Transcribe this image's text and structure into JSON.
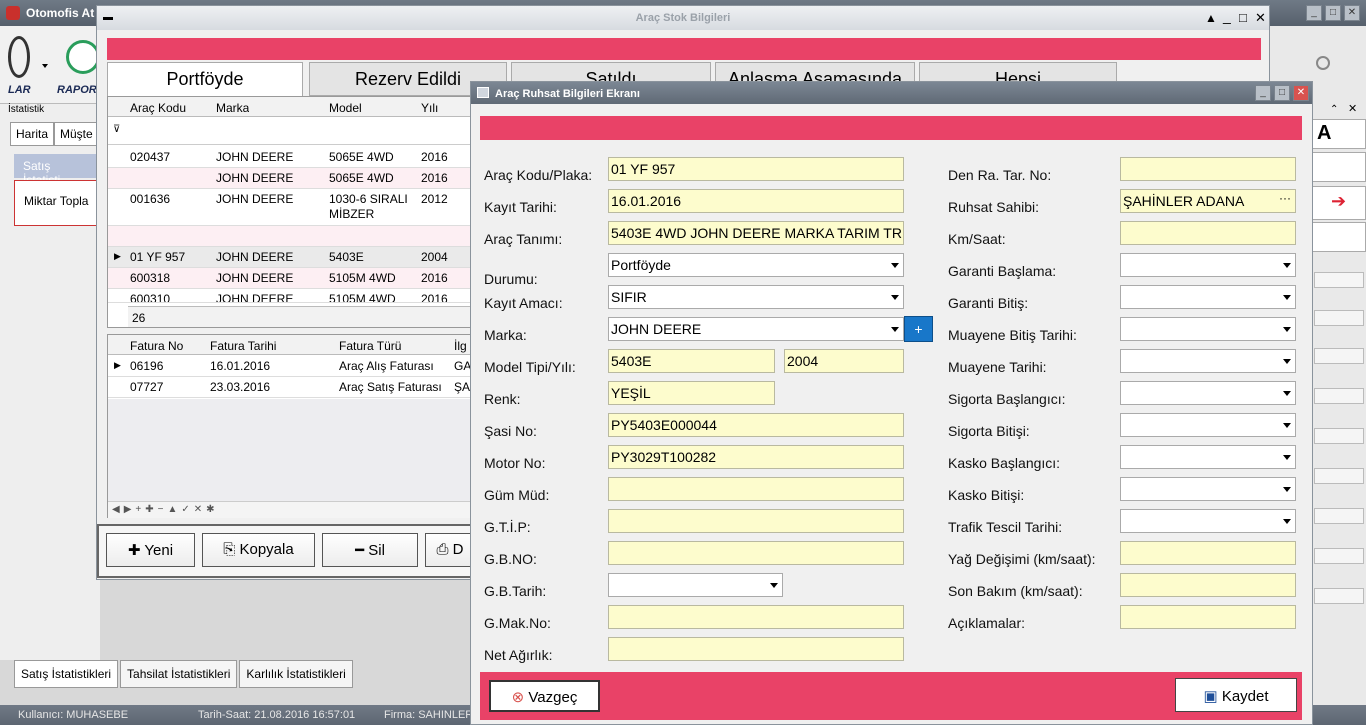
{
  "app": {
    "title": "Otomofis At",
    "ribbon": {
      "item1": "LAR",
      "item2": "RAPOR"
    },
    "stat_label": "İstatistik",
    "left_tabs": [
      "Harita",
      "Müşte"
    ],
    "sales_head": "Satış İstatisti",
    "qty_label": "Miktar Topla",
    "bottom_tabs": [
      "Satış İstatistikleri",
      "Tahsilat İstatistikleri",
      "Karlılık İstatistikleri"
    ],
    "status": {
      "user": "Kullanıcı: MUHASEBE",
      "datetime": "Tarih-Saat: 21.08.2016 16:57:01",
      "firm": "Firma: SAHINLER"
    },
    "right_letter": "A"
  },
  "stok": {
    "title": "Araç Stok Bilgileri",
    "tabs": [
      "Portföyde",
      "Rezerv Edildi",
      "Satıldı",
      "Anlaşma Aşamasında",
      "Hepsi"
    ],
    "columns": [
      "Araç Kodu",
      "Marka",
      "Model",
      "Yılı"
    ],
    "rows": [
      {
        "kod": "020437",
        "marka": "JOHN DEERE",
        "model": "5065E 4WD",
        "yil": "2016"
      },
      {
        "kod": "",
        "marka": "JOHN DEERE",
        "model": "5065E 4WD",
        "yil": "2016"
      },
      {
        "kod": "001636",
        "marka": "JOHN DEERE",
        "model": "1030-6 SIRALI MİBZER",
        "yil": "2012"
      },
      {
        "kod": "",
        "marka": "",
        "model": "",
        "yil": ""
      },
      {
        "kod": "01 YF 957",
        "marka": "JOHN DEERE",
        "model": "5403E",
        "yil": "2004"
      },
      {
        "kod": "600318",
        "marka": "JOHN DEERE",
        "model": "5105M 4WD",
        "yil": "2016"
      },
      {
        "kod": "600310",
        "marka": "JOHN DEERE",
        "model": "5105M 4WD",
        "yil": "2016"
      }
    ],
    "count": "26",
    "fatura_columns": [
      "Fatura No",
      "Fatura Tarihi",
      "Fatura Türü",
      "İlg"
    ],
    "fatura_rows": [
      {
        "no": "06196",
        "tarih": "16.01.2016",
        "tur": "Araç Alış Faturası",
        "ilg": "GA"
      },
      {
        "no": "07727",
        "tarih": "23.03.2016",
        "tur": "Araç Satış Faturası",
        "ilg": "ŞA"
      }
    ],
    "buttons": {
      "new": "Yeni",
      "copy": "Kopyala",
      "delete": "Sil",
      "other": "D"
    }
  },
  "ruhsat": {
    "title": "Araç Ruhsat Bilgileri Ekranı",
    "labels_left": [
      "Araç Kodu/Plaka:",
      "Kayıt Tarihi:",
      "Araç Tanımı:",
      "Durumu:",
      "Kayıt Amacı:",
      "Marka:",
      "Model Tipi/Yılı:",
      "Renk:",
      "Şasi No:",
      "Motor No:",
      "Güm Müd:",
      "G.T.İ.P:",
      "G.B.NO:",
      "G.B.Tarih:",
      "G.Mak.No:",
      "Net Ağırlık:"
    ],
    "labels_right": [
      "Den Ra. Tar. No:",
      "Ruhsat Sahibi:",
      "Km/Saat:",
      "Garanti Başlama:",
      "Garanti Bitiş:",
      "Muayene Bitiş Tarihi:",
      "Muayene Tarihi:",
      "Sigorta Başlangıcı:",
      "Sigorta Bitişi:",
      "Kasko Başlangıcı:",
      "Kasko Bitişi:",
      "Trafik Tescil Tarihi:",
      "Yağ Değişimi (km/saat):",
      "Son Bakım (km/saat):",
      "Açıklamalar:"
    ],
    "values": {
      "plaka": "01 YF 957",
      "kayit_tarihi": "16.01.2016",
      "arac_tanimi": "5403E 4WD JOHN DEERE MARKA TARIM TR",
      "durumu": "Portföyde",
      "kayit_amaci": "SIFIR",
      "marka": "JOHN DEERE",
      "model_tipi": "5403E",
      "model_yili": "2004",
      "renk": "YEŞİL",
      "sasi_no": "PY5403E000044",
      "motor_no": "PY3029T100282",
      "ruhsat_sahibi": "ŞAHİNLER ADANA"
    },
    "cancel": "Vazgeç",
    "save": "Kaydet"
  }
}
